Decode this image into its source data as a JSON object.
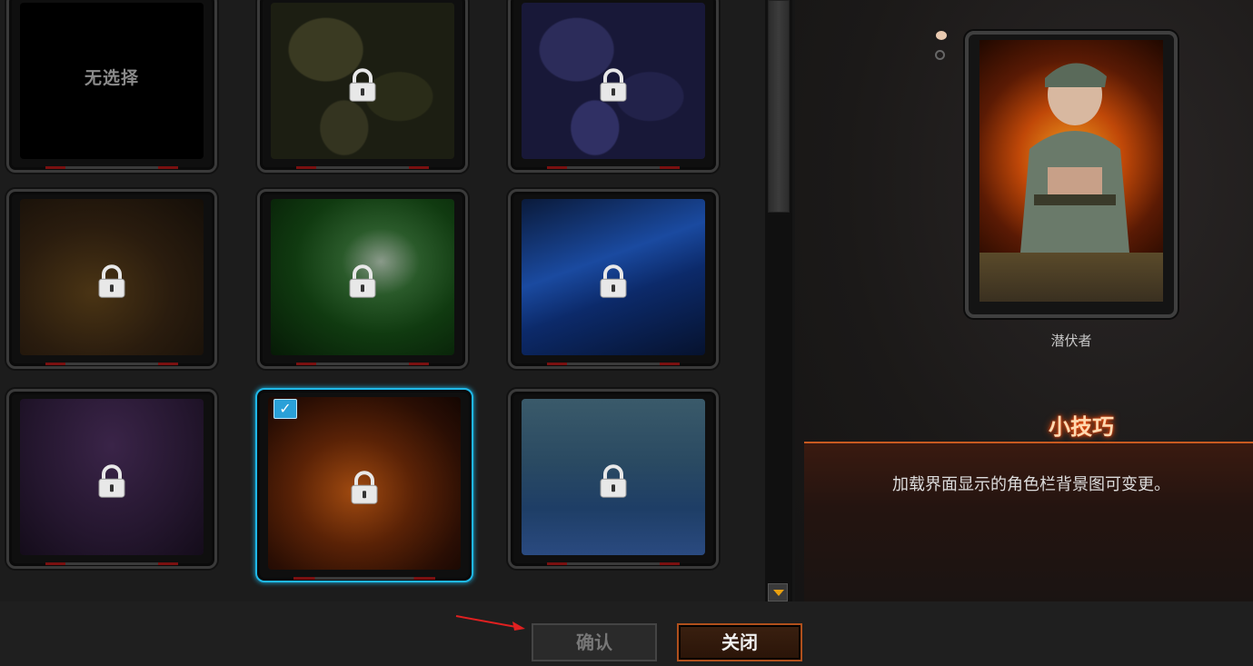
{
  "cards": [
    {
      "id": "none",
      "label": "无选择",
      "locked": false,
      "selected": false,
      "bg": "#000000"
    },
    {
      "id": "camo-green",
      "label": "",
      "locked": true,
      "selected": false,
      "bg": "camo-green"
    },
    {
      "id": "camo-blue",
      "label": "",
      "locked": true,
      "selected": false,
      "bg": "camo-blue"
    },
    {
      "id": "bokeh-brown",
      "label": "",
      "locked": true,
      "selected": false,
      "bg": "bokeh-brown"
    },
    {
      "id": "galaxy-green",
      "label": "",
      "locked": true,
      "selected": false,
      "bg": "galaxy-green"
    },
    {
      "id": "hex-blue",
      "label": "",
      "locked": true,
      "selected": false,
      "bg": "hex-blue"
    },
    {
      "id": "hearts-purple",
      "label": "",
      "locked": true,
      "selected": false,
      "bg": "hearts-purple"
    },
    {
      "id": "fire-orange",
      "label": "",
      "locked": true,
      "selected": true,
      "bg": "fire-orange"
    },
    {
      "id": "ice-blue",
      "label": "",
      "locked": true,
      "selected": false,
      "bg": "ice-blue"
    }
  ],
  "preview": {
    "character_name": "潜伏者"
  },
  "tips": {
    "title": "小技巧",
    "text": "加载界面显示的角色栏背景图可变更。"
  },
  "buttons": {
    "confirm": "确认",
    "close": "关闭"
  },
  "colors": {
    "selected_border": "#1fb8e8",
    "accent": "#c85a20"
  }
}
